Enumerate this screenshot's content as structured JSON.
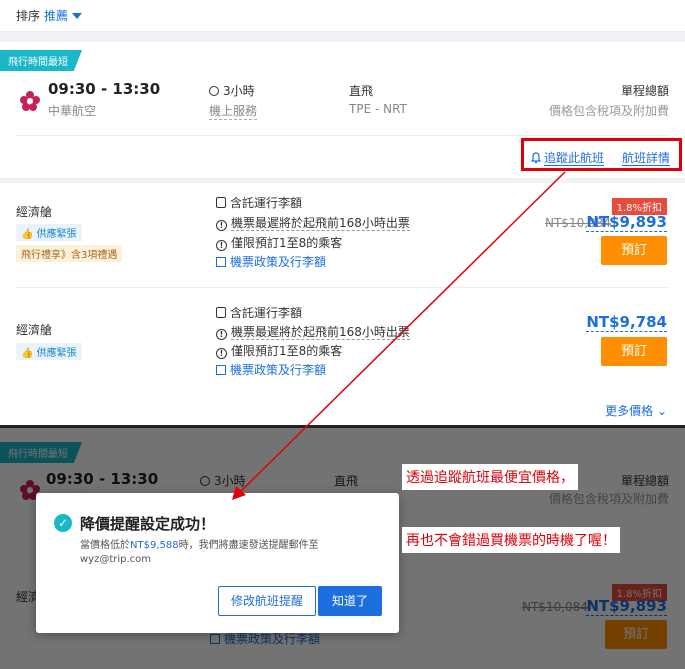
{
  "sort": {
    "label": "排序",
    "value": "推薦"
  },
  "flight": {
    "ribbon": "飛行時間最短",
    "time": "09:30 - 13:30",
    "airline": "中華航空",
    "duration": "3小時",
    "service": "機上服務",
    "type": "直飛",
    "route": "TPE - NRT",
    "total_label": "單程總額",
    "total_note": "價格包含稅項及附加費",
    "track_label": "追蹤此航班",
    "details_label": "航班詳情"
  },
  "fares": [
    {
      "cabin": "經濟艙",
      "tag1": "供應緊張",
      "tag2": "飛行禮享》含3項禮遇",
      "feat1": "含託運行李額",
      "feat2": "機票最遲將於起飛前168小時出票",
      "feat3": "僅限預訂1至8的乘客",
      "feat4": "機票政策及行李額",
      "discount": "1.8%折扣",
      "old_price": "NT$10,084",
      "price": "NT$9,893",
      "book": "預訂"
    },
    {
      "cabin": "經濟艙",
      "tag1": "供應緊張",
      "feat1": "含託運行李額",
      "feat2": "機票最遲將於起飛前168小時出票",
      "feat3": "僅限預訂1至8的乘客",
      "feat4": "機票政策及行李額",
      "price": "NT$9,784",
      "book": "預訂"
    }
  ],
  "more_prices": "更多價格",
  "modal": {
    "title": "降價提醒設定成功！",
    "msg_prefix": "當價格低於",
    "msg_price": "NT$9,588",
    "msg_suffix": "時，我們將盡速發送提醒郵件至",
    "email": "wyz@trip.com",
    "btn_modify": "修改航班提醒",
    "btn_ok": "知道了"
  },
  "callouts": {
    "line1": "透過追蹤航班最便宜價格，",
    "line2": "再也不會錯過買機票的時機了喔！"
  },
  "colors": {
    "accent": "#1d6fe0",
    "book": "#ff8f00",
    "ribbon": "#1ab7c8",
    "highlight": "#e0000a"
  }
}
